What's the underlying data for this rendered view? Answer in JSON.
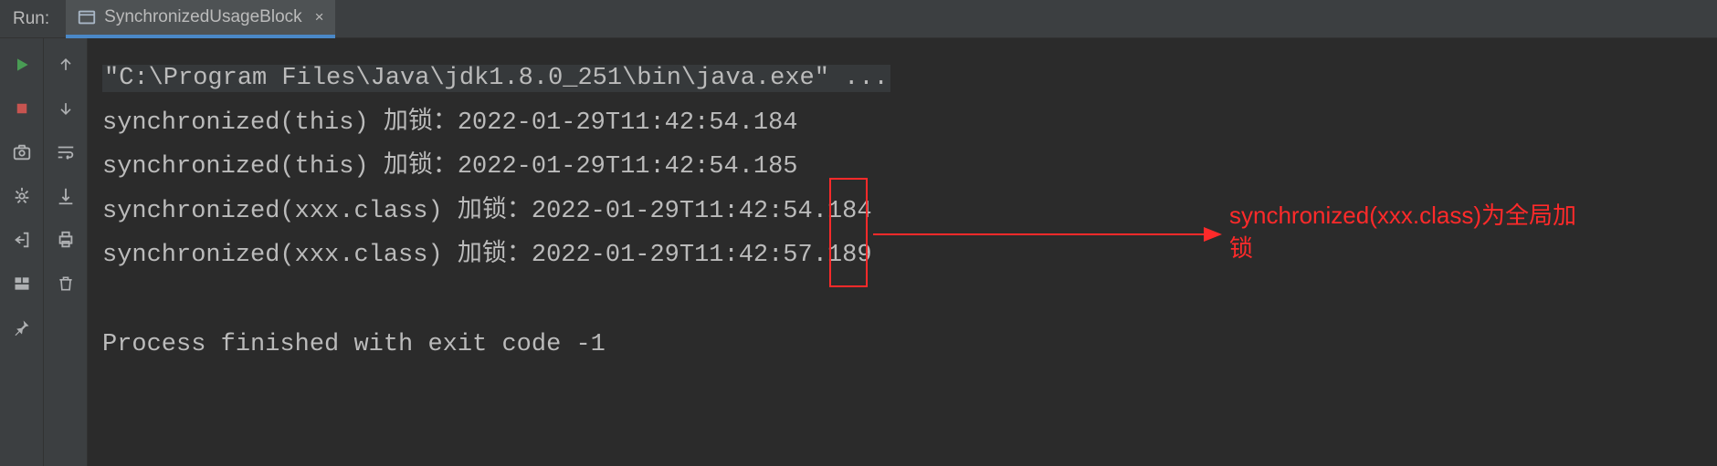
{
  "header": {
    "run_label": "Run:",
    "tab_title": "SynchronizedUsageBlock",
    "tab_close": "×"
  },
  "console": {
    "cmd": "\"C:\\Program Files\\Java\\jdk1.8.0_251\\bin\\java.exe\" ...",
    "lines": [
      "synchronized(this) 加锁：2022-01-29T11:42:54.184",
      "synchronized(this) 加锁：2022-01-29T11:42:54.185",
      "synchronized(xxx.class) 加锁：2022-01-29T11:42:54.184",
      "synchronized(xxx.class) 加锁：2022-01-29T11:42:57.189"
    ],
    "exit_line": "Process finished with exit code -1"
  },
  "annotation": {
    "text": "synchronized(xxx.class)为全局加锁"
  },
  "icons": {
    "run": "run-icon",
    "stop": "stop-icon",
    "camera": "camera-icon",
    "debug": "debug-icon",
    "exit": "exit-icon",
    "layout": "layout-icon",
    "pin": "pin-icon",
    "up": "up-arrow-icon",
    "down": "down-arrow-icon",
    "wrap": "wrap-icon",
    "scroll": "scroll-icon",
    "print": "print-icon",
    "trash": "trash-icon"
  }
}
